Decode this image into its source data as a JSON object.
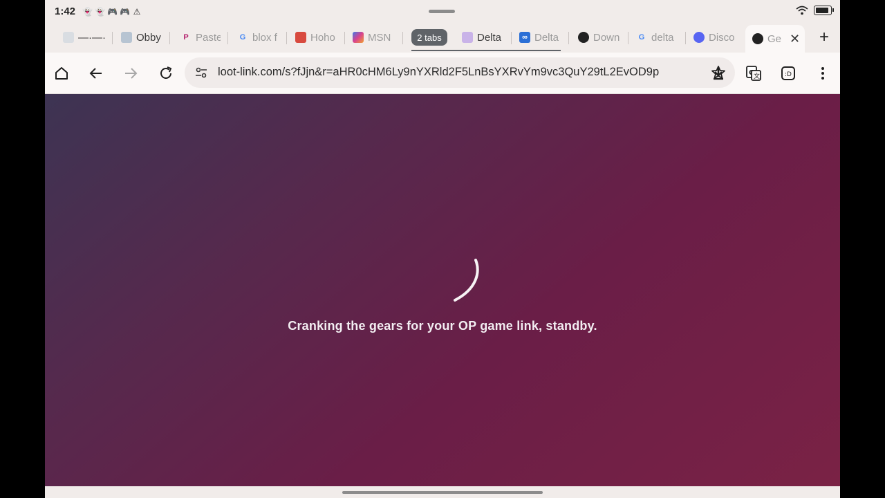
{
  "status_bar": {
    "time": "1:42",
    "notification_icons": [
      "snapchat-icon",
      "snapchat-icon",
      "game-controller-icon",
      "game-controller-icon",
      "warning-icon"
    ]
  },
  "tabs": [
    {
      "label": "—·—·",
      "icon": "roblox-icon"
    },
    {
      "label": "Obby",
      "icon": "roblox-icon"
    },
    {
      "label": "Paste",
      "icon": "pastebin-icon"
    },
    {
      "label": "blox f",
      "icon": "google-icon"
    },
    {
      "label": "Hoho",
      "icon": "hoho-icon"
    },
    {
      "label": "MSN",
      "icon": "msn-icon"
    },
    {
      "label": "Delta",
      "icon": "delta-icon"
    },
    {
      "label": "Delta",
      "icon": "delta-icon"
    },
    {
      "label": "Down",
      "icon": "globe-icon"
    },
    {
      "label": "delta",
      "icon": "google-icon"
    },
    {
      "label": "Disco",
      "icon": "discord-icon"
    },
    {
      "label": "Ge",
      "icon": "globe-icon"
    }
  ],
  "tab_group": {
    "label": "2 tabs"
  },
  "toolbar": {
    "url": "loot-link.com/s?fJjn&r=aHR0cHM6Ly9nYXRld2F5LnBsYXRvYm9vc3QuY29tL2EvOD9p"
  },
  "content": {
    "loading_text": "Cranking the gears for your OP game link, standby."
  },
  "colors": {
    "gradient_start": "#3d3453",
    "gradient_end": "#7a2245",
    "chrome_bg": "#f1ecea"
  }
}
